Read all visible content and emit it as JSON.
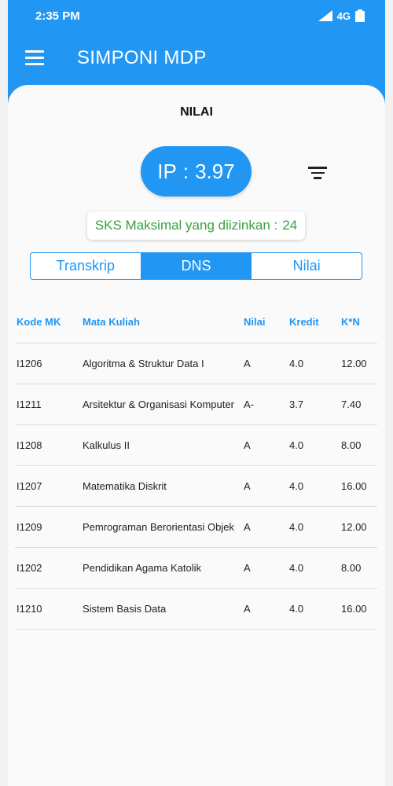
{
  "status": {
    "time": "2:35 PM",
    "network": "4G"
  },
  "app": {
    "title": "SIMPONI MDP"
  },
  "page": {
    "title": "NILAI"
  },
  "ip": {
    "label": "IP",
    "separator": ":",
    "value": "3.97"
  },
  "sks": {
    "label": "SKS Maksimal yang diizinkan :",
    "value": "24"
  },
  "tabs": [
    {
      "label": "Transkrip"
    },
    {
      "label": "DNS"
    },
    {
      "label": "Nilai"
    }
  ],
  "table": {
    "headers": [
      "Kode MK",
      "Mata Kuliah",
      "Nilai",
      "Kredit",
      "K*N"
    ],
    "rows": [
      [
        "I1206",
        "Algoritma & Struktur Data I",
        "A",
        "4.0",
        "12.00"
      ],
      [
        "I1211",
        "Arsitektur & Organisasi Komputer",
        "A-",
        "3.7",
        "7.40"
      ],
      [
        "I1208",
        "Kalkulus II",
        "A",
        "4.0",
        "8.00"
      ],
      [
        "I1207",
        "Matematika Diskrit",
        "A",
        "4.0",
        "16.00"
      ],
      [
        "I1209",
        "Pemrograman Berorientasi Objek",
        "A",
        "4.0",
        "12.00"
      ],
      [
        "I1202",
        "Pendidikan Agama Katolik",
        "A",
        "4.0",
        "8.00"
      ],
      [
        "I1210",
        "Sistem Basis Data",
        "A",
        "4.0",
        "16.00"
      ]
    ]
  },
  "colors": {
    "primary": "#2196f3",
    "sks_text": "#3aa142"
  },
  "icons": [
    "menu-icon",
    "filter-icon",
    "signal-icon",
    "battery-icon"
  ]
}
